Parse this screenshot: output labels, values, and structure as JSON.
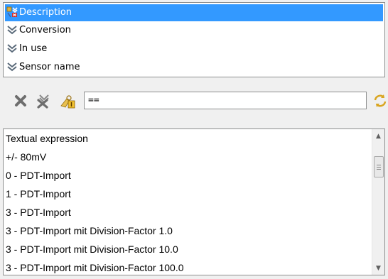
{
  "columns": {
    "items": [
      {
        "label": "Description",
        "icon": "column-special-icon",
        "selected": true
      },
      {
        "label": "Conversion",
        "icon": "chevron-double-down-icon",
        "selected": false
      },
      {
        "label": "In use",
        "icon": "chevron-double-down-icon",
        "selected": false
      },
      {
        "label": "Sensor name",
        "icon": "chevron-double-down-icon",
        "selected": false
      }
    ]
  },
  "toolbar": {
    "clear_icon": "x-icon",
    "clear_all_icon": "x-arrows-icon",
    "filter_lock_icon": "lock-key-icon",
    "filter_value": "==",
    "refresh_icon": "refresh-arrows-icon"
  },
  "values": {
    "header": "Textual expression",
    "rows": [
      "+/- 80mV",
      "0 - PDT-Import",
      "1 - PDT-Import",
      "3 - PDT-Import",
      "3 - PDT-Import mit Division-Factor 1.0",
      "3 - PDT-Import mit Division-Factor 10.0",
      "3 - PDT-Import mit Division-Factor 100.0"
    ]
  },
  "colors": {
    "selection": "#3399ff",
    "border": "#8e8f8f",
    "chevron": "#5a6a7a",
    "gold": "#d9a520"
  }
}
